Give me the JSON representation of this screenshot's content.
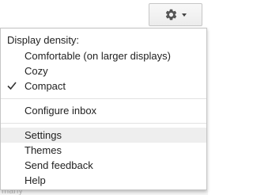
{
  "toolbar": {
    "settings_icon": "gear-icon",
    "dropdown_icon": "caret-down-icon"
  },
  "menu": {
    "density_heading": "Display density:",
    "density_options": [
      {
        "label": "Comfortable (on larger displays)",
        "checked": false
      },
      {
        "label": "Cozy",
        "checked": false
      },
      {
        "label": "Compact",
        "checked": true
      }
    ],
    "configure_inbox": "Configure inbox",
    "items": [
      {
        "label": "Settings",
        "highlighted": true
      },
      {
        "label": "Themes",
        "highlighted": false
      },
      {
        "label": "Send feedback",
        "highlighted": false
      },
      {
        "label": "Help",
        "highlighted": false
      }
    ]
  },
  "background": {
    "partial_text": "many"
  },
  "colors": {
    "hover": "#eeeeee",
    "text": "#222222",
    "border": "#c5c5c5"
  }
}
